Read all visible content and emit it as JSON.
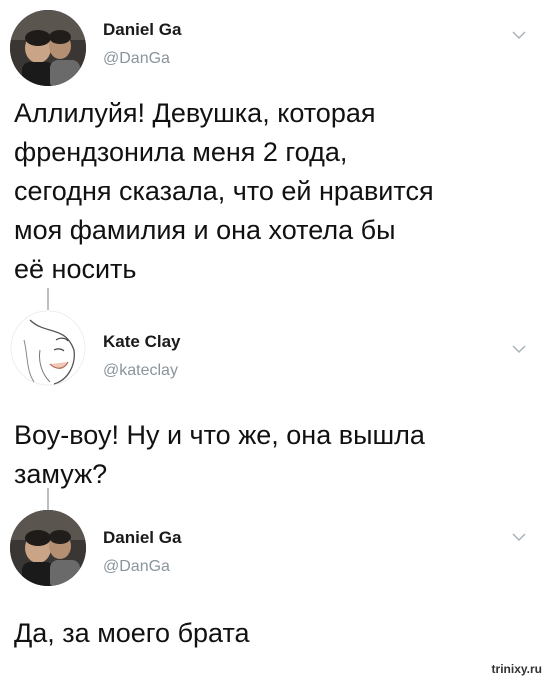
{
  "tweets": [
    {
      "name": "Daniel Ga",
      "handle": "@DanGa",
      "text": "Аллилуйя! Девушка, которая\nфрендзонила меня 2 года,\nсегодня сказала, что ей нравится\nмоя фамилия и она хотела бы\nеё носить",
      "avatar": "photo-avatar",
      "menu_icon": "chevron-down-icon"
    },
    {
      "name": "Kate Clay",
      "handle": "@kateclay",
      "text": "Воу-воу! Ну и что же, она вышла\nзамуж?",
      "avatar": "sketch-avatar",
      "menu_icon": "chevron-down-icon"
    },
    {
      "name": "Daniel Ga",
      "handle": "@DanGa",
      "text": "Да, за моего брата",
      "avatar": "photo-avatar",
      "menu_icon": "chevron-down-icon"
    }
  ],
  "watermark": "trinixy.ru",
  "colors": {
    "text": "#111111",
    "handle": "#8a949c",
    "connector": "#b9c0c6",
    "background": "#ffffff"
  }
}
